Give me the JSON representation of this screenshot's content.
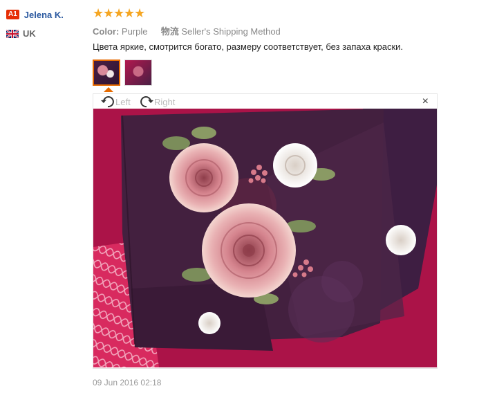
{
  "user": {
    "level_badge": "A1",
    "name": "Jelena K.",
    "country": "UK"
  },
  "review": {
    "rating": 5,
    "stars": [
      "★",
      "★",
      "★",
      "★",
      "★"
    ],
    "color_label": "Color:",
    "color_value": "Purple",
    "shipping_label": "物流",
    "shipping_value": "Seller's Shipping Method",
    "text": "Цвета яркие, смотрится богато, размеру соответствует, без запаха краски.",
    "date": "09 Jun 2016 02:18"
  },
  "viewer": {
    "rotate_left_label": "Left",
    "rotate_right_label": "Right",
    "close_glyph": "×"
  },
  "colors": {
    "accent_orange": "#e66a00",
    "star": "#f5a623",
    "name_blue": "#2c5aa0",
    "badge_red": "#e62e04"
  }
}
